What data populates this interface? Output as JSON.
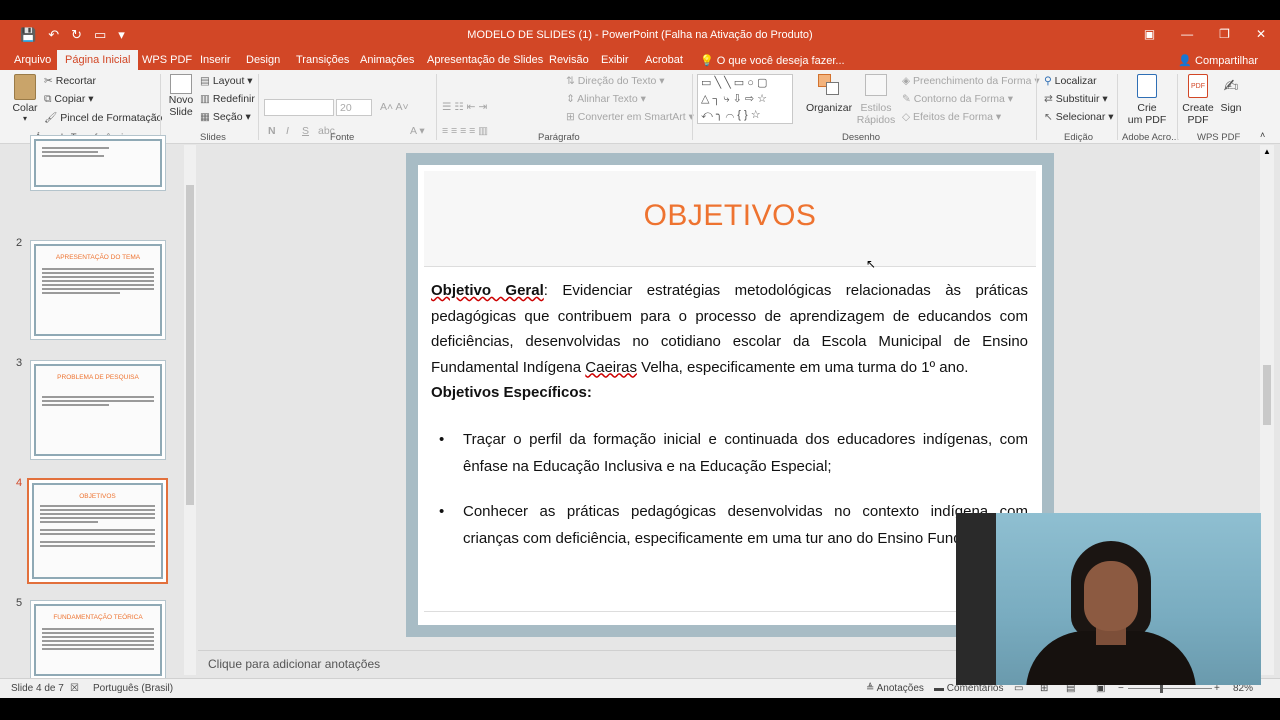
{
  "window": {
    "title": "MODELO DE SLIDES (1) - PowerPoint (Falha na Ativação do Produto)",
    "brand_color": "#d24726"
  },
  "quick_access": [
    "save-icon",
    "undo-icon",
    "redo-icon",
    "start-icon"
  ],
  "tabs": [
    {
      "label": "Arquivo"
    },
    {
      "label": "Página Inicial",
      "active": true
    },
    {
      "label": "WPS PDF"
    },
    {
      "label": "Inserir"
    },
    {
      "label": "Design"
    },
    {
      "label": "Transições"
    },
    {
      "label": "Animações"
    },
    {
      "label": "Apresentação de Slides"
    },
    {
      "label": "Revisão"
    },
    {
      "label": "Exibir"
    },
    {
      "label": "Acrobat"
    },
    {
      "label": "O que você deseja fazer..."
    }
  ],
  "share_label": "Compartilhar",
  "ribbon": {
    "clipboard": {
      "paste": "Colar",
      "cut": "Recortar",
      "copy": "Copiar",
      "format_painter": "Pincel de Formatação",
      "label": "Área de Transferência"
    },
    "slides": {
      "new_slide_1": "Novo",
      "new_slide_2": "Slide",
      "layout": "Layout",
      "reset": "Redefinir",
      "section": "Seção",
      "label": "Slides"
    },
    "font": {
      "size": "20",
      "bold": "N",
      "italic": "I",
      "underline": "S",
      "label": "Fonte"
    },
    "paragraph": {
      "text_direction": "Direção do Texto",
      "align_text": "Alinhar Texto",
      "smartart": "Converter em SmartArt",
      "label": "Parágrafo"
    },
    "drawing": {
      "arrange": "Organizar",
      "quick_styles_1": "Estilos",
      "quick_styles_2": "Rápidos",
      "shape_fill": "Preenchimento da Forma",
      "shape_outline": "Contorno da Forma",
      "shape_effects": "Efeitos de Forma",
      "label": "Desenho"
    },
    "editing": {
      "find": "Localizar",
      "replace": "Substituir",
      "select": "Selecionar",
      "label": "Edição"
    },
    "adobe": {
      "create_pdf_1": "Crie",
      "create_pdf_2": "um PDF",
      "label": "Adobe Acro..."
    },
    "wps": {
      "create_pdf_1": "Create",
      "create_pdf_2": "PDF",
      "sign": "Sign",
      "label": "WPS PDF"
    }
  },
  "thumbnails": [
    {
      "num": "",
      "title": ""
    },
    {
      "num": "2",
      "title": "APRESENTAÇÃO DO TEMA"
    },
    {
      "num": "3",
      "title": "PROBLEMA DE PESQUISA"
    },
    {
      "num": "4",
      "title": "OBJETIVOS",
      "selected": true
    },
    {
      "num": "5",
      "title": "FUNDAMENTAÇÃO TEÓRICA"
    }
  ],
  "slide": {
    "title": "OBJETIVOS",
    "general_label": "Objetivo Geral",
    "general_text_1": ": Evidenciar estratégias metodológicas relacionadas às práticas pedagógicas que contribuem para o processo de aprendizagem de educandos com deficiências, desenvolvidas no cotidiano escolar da Escola Municipal de Ensino Fundamental Indígena ",
    "general_text_2": "Caeiras",
    "general_text_3": " Velha, especificamente em uma turma do 1º ano.",
    "specific_label": "Objetivos Específicos:",
    "bullets": [
      "Traçar o perfil da formação inicial e continuada dos educadores indígenas, com ênfase na Educação Inclusiva e na Educação Especial;",
      "Conhecer as práticas pedagógicas desenvolvidas no contexto indígena com crianças com deficiência, especificamente em uma tur ano do Ensino Fundamental."
    ],
    "title_color": "#ee7330"
  },
  "notes_placeholder": "Clique para adicionar anotações",
  "status": {
    "slide_count": "Slide 4 de 7",
    "language": "Português (Brasil)",
    "notes": "Anotações",
    "comments": "Comentários",
    "zoom": "82%"
  }
}
